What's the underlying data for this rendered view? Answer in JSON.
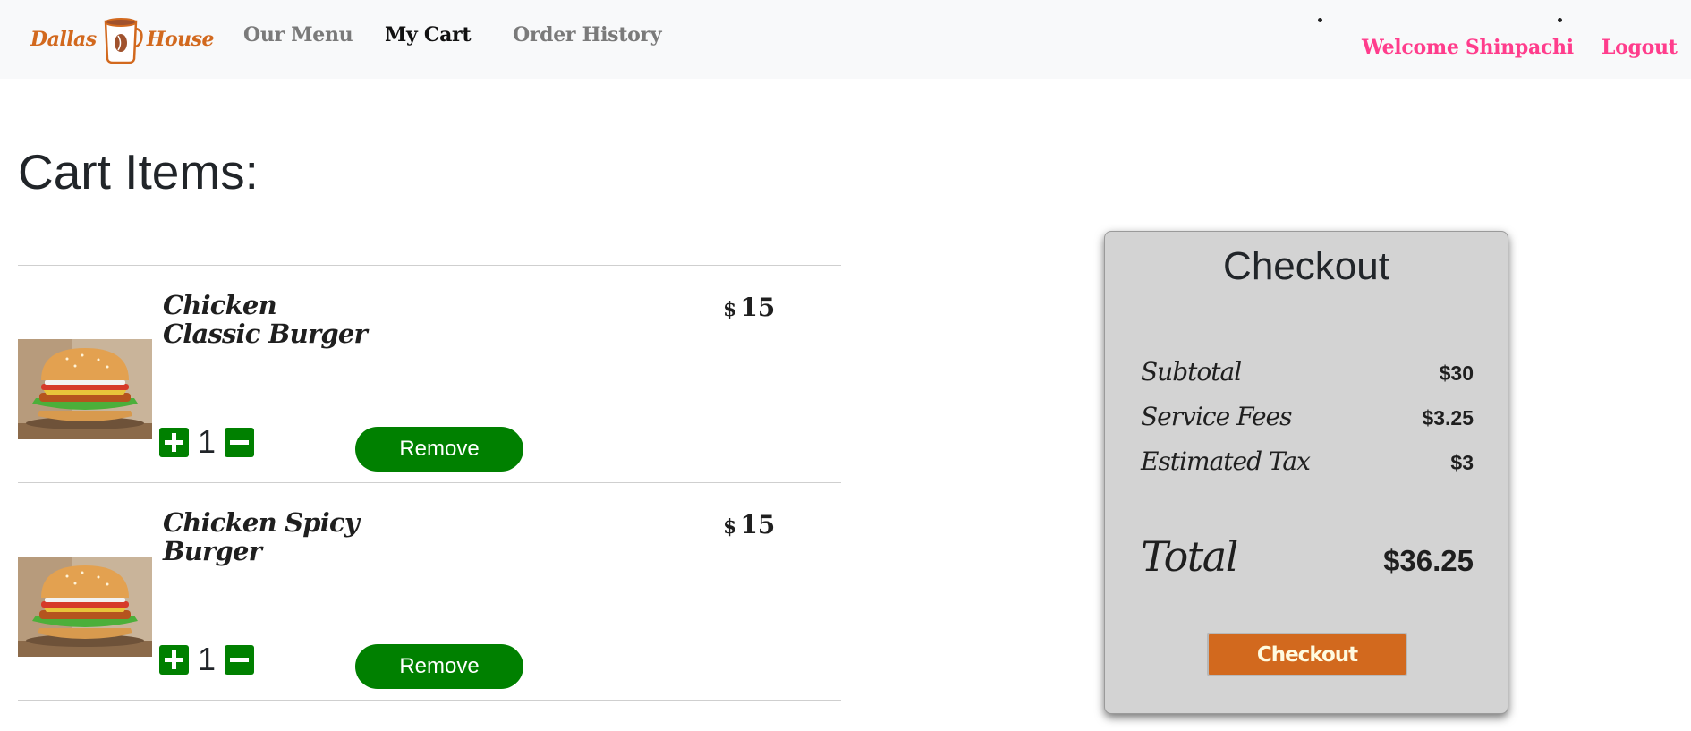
{
  "nav": {
    "brand_left": "Dallas",
    "brand_right": "House",
    "links": {
      "menu": "Our Menu",
      "cart": "My Cart",
      "history": "Order History"
    },
    "welcome": "Welcome Shinpachi",
    "logout": "Logout"
  },
  "page_title": "Cart Items:",
  "cart": {
    "currency": "$",
    "items": [
      {
        "name": "Chicken Classic Burger",
        "price": "15",
        "qty": "1",
        "remove_label": "Remove",
        "image_icon": "burger-image"
      },
      {
        "name": "Chicken Spicy Burger",
        "price": "15",
        "qty": "1",
        "remove_label": "Remove",
        "image_icon": "burger-image"
      }
    ]
  },
  "checkout": {
    "title": "Checkout",
    "subtotal_label": "Subtotal",
    "subtotal_value": "$30",
    "fees_label": "Service Fees",
    "fees_value": "$3.25",
    "tax_label": "Estimated Tax",
    "tax_value": "$3",
    "total_label": "Total",
    "total_value": "$36.25",
    "button_label": "Checkout"
  },
  "colors": {
    "accent_green": "#008000",
    "brand_orange": "#d2691e",
    "welcome_pink": "#ff3d8c",
    "panel_gray": "#d3d3d3"
  }
}
